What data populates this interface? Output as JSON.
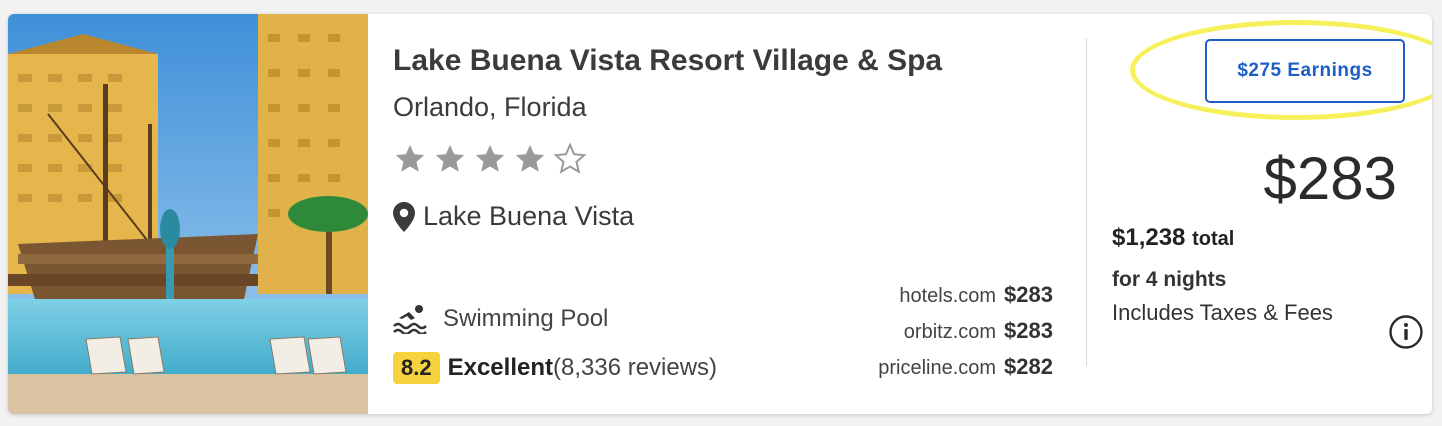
{
  "hotel": {
    "name": "Lake Buena Vista Resort Village & Spa",
    "city": "Orlando, Florida",
    "star_rating": 4,
    "star_max": 5,
    "location": "Lake Buena Vista",
    "amenity": "Swimming Pool",
    "score": "8.2",
    "score_label": "Excellent",
    "reviews": "(8,336 reviews)"
  },
  "sites": [
    {
      "name": "hotels.com",
      "price": "$283"
    },
    {
      "name": "orbitz.com",
      "price": "$283"
    },
    {
      "name": "priceline.com",
      "price": "$282"
    }
  ],
  "pricing": {
    "earnings_label": "$275 Earnings",
    "nightly": "$283",
    "total_amount": "$1,238",
    "total_word": "total",
    "nights": "for 4 nights",
    "taxes_note": "Includes Taxes & Fees"
  },
  "colors": {
    "accent_blue": "#1d5fc7",
    "score_yellow": "#f7d23e",
    "highlight_yellow": "#f6f15a",
    "star_gray": "#9a9a9a"
  },
  "icons": {
    "location": "map-pin-icon",
    "amenity": "swimming-icon",
    "info": "info-icon",
    "star_filled": "star-filled-icon",
    "star_empty": "star-outline-icon"
  }
}
